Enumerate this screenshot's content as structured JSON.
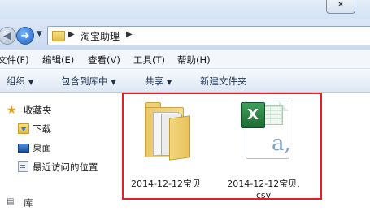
{
  "address": {
    "folder_label": "淘宝助理"
  },
  "menu": {
    "file": "文件(F)",
    "edit": "编辑(E)",
    "view": "查看(V)",
    "tools": "工具(T)",
    "help": "帮助(H)"
  },
  "commands": {
    "organize": "组织",
    "include_in_library": "包含到库中",
    "share": "共享",
    "new_folder": "新建文件夹"
  },
  "nav": {
    "favorites": "收藏夹",
    "downloads": "下载",
    "desktop": "桌面",
    "recent": "最近访问的位置",
    "libraries": "库"
  },
  "files": [
    {
      "name": "2014-12-12宝贝",
      "icon": "folder-icon"
    },
    {
      "name_line1": "2014-12-12宝贝.",
      "name_line2": "csv",
      "icon": "excel-csv-icon"
    }
  ],
  "colors": {
    "selection_highlight": "#e3202a",
    "folder": "#f6dc8a",
    "excel_green": "#1c6b33"
  }
}
